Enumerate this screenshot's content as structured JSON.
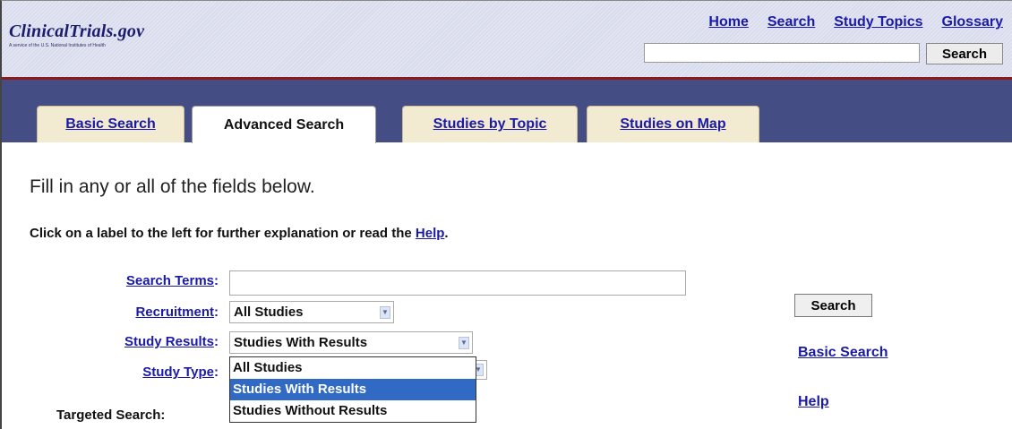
{
  "header": {
    "logo_title": "ClinicalTrials.gov",
    "logo_subtitle": "A service of the U.S. National Institutes of Health",
    "nav": [
      "Home",
      "Search",
      "Study Topics",
      "Glossary"
    ],
    "search_value": "",
    "search_button": "Search"
  },
  "tabs": [
    {
      "label": "Basic Search",
      "active": false
    },
    {
      "label": "Advanced Search",
      "active": true
    },
    {
      "label": "Studies by Topic",
      "active": false
    },
    {
      "label": "Studies on Map",
      "active": false
    }
  ],
  "main": {
    "intro": "Fill in any or all of the fields below.",
    "instruction_prefix": "Click on a label to the left for further explanation or read the ",
    "instruction_link": "Help",
    "instruction_suffix": "."
  },
  "form": {
    "search_terms_label": "Search Terms",
    "search_terms_value": "",
    "recruitment_label": "Recruitment",
    "recruitment_value": "All Studies",
    "study_results_label": "Study Results",
    "study_results_value": "Studies With Results",
    "study_type_label": "Study Type",
    "targeted_label": "Targeted Search:",
    "dropdown_options": [
      "All Studies",
      "Studies With Results",
      "Studies Without Results"
    ],
    "dropdown_selected": "Studies With Results",
    "colon": ":"
  },
  "side": {
    "search_button": "Search",
    "basic_search_link": "Basic Search",
    "help_link": "Help"
  },
  "colors": {
    "tab_band": "#444e84",
    "link": "#1a1aa6",
    "header_rule": "#8b1a1a",
    "dropdown_highlight": "#316ac5"
  },
  "icons": [
    "chevron-down-icon"
  ]
}
